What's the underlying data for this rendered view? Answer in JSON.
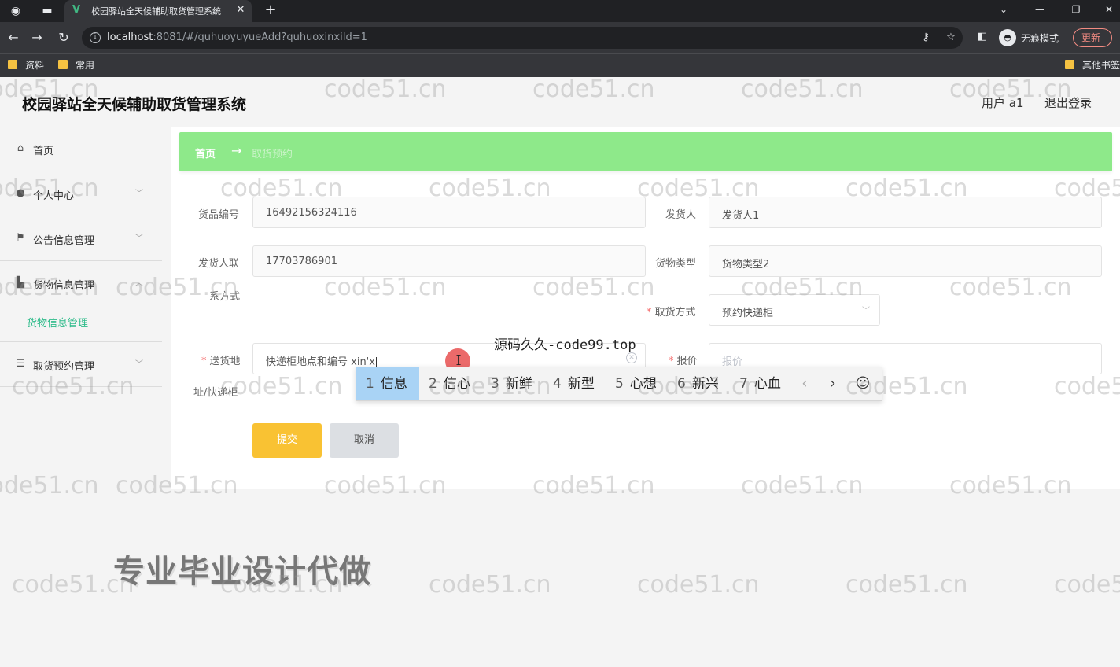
{
  "browser": {
    "tab_title": "校园驿站全天候辅助取货管理系统",
    "url_host": "localhost",
    "url_path": ":8081/#/quhuoyuyueAdd?quhuoxinxiId=1",
    "incognito_label": "无痕模式",
    "update_label": "更新",
    "bookmarks": [
      "资料",
      "常用"
    ],
    "other_bookmarks": "其他书签"
  },
  "header": {
    "app_title": "校园驿站全天候辅助取货管理系统",
    "user_label": "用户 a1",
    "logout_label": "退出登录"
  },
  "sidebar": {
    "items": [
      {
        "label": "首页",
        "icon": "home-icon"
      },
      {
        "label": "个人中心",
        "icon": "person-icon"
      },
      {
        "label": "公告信息管理",
        "icon": "flag-icon"
      },
      {
        "label": "货物信息管理",
        "icon": "chart-icon"
      },
      {
        "label": "取货预约管理",
        "icon": "list-icon"
      }
    ],
    "submenu_active": "货物信息管理"
  },
  "breadcrumb": {
    "home": "首页",
    "separator": "→",
    "current": "取货预约"
  },
  "form": {
    "goods_no_label": "货品编号",
    "goods_no_value": "16492156324116",
    "sender_label": "发货人",
    "sender_value": "发货人1",
    "sender_phone_label_1": "发货人联",
    "sender_phone_label_2": "系方式",
    "sender_phone_value": "17703786901",
    "goods_type_label": "货物类型",
    "goods_type_value": "货物类型2",
    "pickup_method_label": "取货方式",
    "pickup_method_value": "预约快递柜",
    "address_label_1": "送货地",
    "address_label_2": "址/快递柜",
    "address_value": "快递柜地点和编号 xin'x",
    "price_label": "报价",
    "price_placeholder": "报价",
    "required_mark": "*",
    "submit_label": "提交",
    "cancel_label": "取消"
  },
  "ime": {
    "candidates": [
      {
        "num": "1",
        "text": "信息"
      },
      {
        "num": "2",
        "text": "信心"
      },
      {
        "num": "3",
        "text": "新鲜"
      },
      {
        "num": "4",
        "text": "新型"
      },
      {
        "num": "5",
        "text": "心想"
      },
      {
        "num": "6",
        "text": "新兴"
      },
      {
        "num": "7",
        "text": "心血"
      }
    ],
    "prev": "‹",
    "next": "›",
    "emoji": "☺"
  },
  "overlay_text": "源码久久-code99.top",
  "promo_text": "专业毕业设计代做",
  "watermark_text": "code51.cn",
  "colors": {
    "breadcrumb_bg": "#8ee98a",
    "submit_bg": "#f9c233",
    "submenu_active": "#2dbb8a",
    "ime_selected": "#a9d3f5"
  }
}
